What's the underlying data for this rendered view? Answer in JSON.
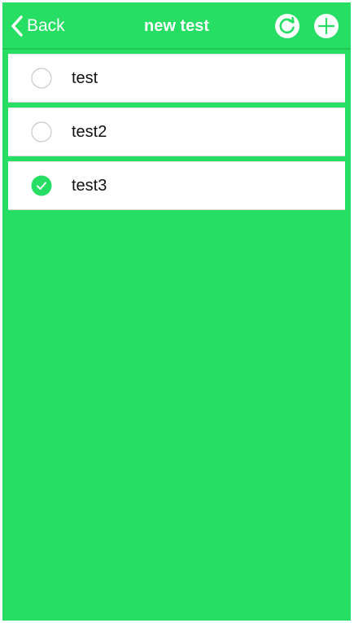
{
  "colors": {
    "background": "#26de63",
    "row_background": "#ffffff",
    "check_checked": "#26de63",
    "check_unchecked_border": "#c8c8c8"
  },
  "navbar": {
    "back_label": "Back",
    "back_icon": "chevron-left-icon",
    "title": "new test",
    "refresh_icon": "refresh-icon",
    "add_icon": "plus-circle-icon"
  },
  "items": [
    {
      "label": "test",
      "checked": false
    },
    {
      "label": "test2",
      "checked": false
    },
    {
      "label": "test3",
      "checked": true
    }
  ]
}
